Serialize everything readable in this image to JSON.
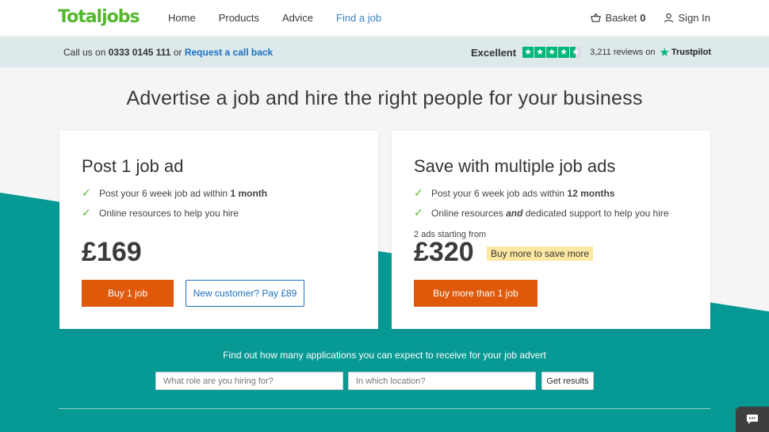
{
  "brand": {
    "logo": "Totaljobs",
    "color": "#55b72e",
    "accent": "#e0590b",
    "teal": "#079994",
    "link": "#1b70c0"
  },
  "nav": {
    "links": [
      "Home",
      "Products",
      "Advice",
      "Find a job"
    ],
    "active": "Find a job",
    "basket_label": "Basket",
    "basket_count": "0",
    "signin_label": "Sign In"
  },
  "callbar": {
    "prefix": "Call us on",
    "phone": "0333 0145 111",
    "or": "or",
    "callback": "Request a call back",
    "rating_label": "Excellent",
    "stars": 4.5,
    "reviews": "3,211",
    "reviews_suffix": "reviews on",
    "trustpilot": "Trustpilot"
  },
  "headline": "Advertise a job and hire the right people for your business",
  "cards": [
    {
      "title": "Post 1 job ad",
      "bullet1_pre": "Post your 6 week job ad within ",
      "bullet1_bold": "1 month",
      "bullet2": "Online resources to help you hire",
      "price": "£169",
      "primary_btn": "Buy 1 job",
      "secondary_btn": "New customer? Pay £89"
    },
    {
      "title": "Save with multiple job ads",
      "bullet1_pre": "Post your 6 week job ads within ",
      "bullet1_bold": "12 months",
      "bullet2_pre": "Online resources ",
      "bullet2_bold": "and",
      "bullet2_post": " dedicated support to help you hire",
      "starting": "2 ads starting from",
      "price": "£320",
      "badge": "Buy more to save more",
      "primary_btn": "Buy more than 1 job"
    }
  ],
  "search": {
    "prompt": "Find out how many applications you can expect to receive for your job advert",
    "role_placeholder": "What role are you hiring for?",
    "location_placeholder": "In which location?",
    "button": "Get results"
  }
}
